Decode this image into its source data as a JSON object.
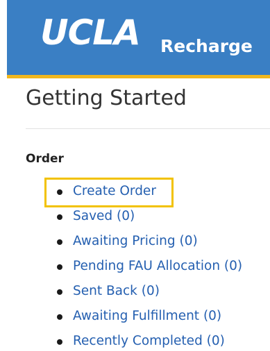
{
  "header": {
    "logo_text": "UCLA",
    "product_name": "Recharge",
    "colors": {
      "background": "#3a7fc4",
      "accent_border": "#f2b71c"
    }
  },
  "page": {
    "title": "Getting Started"
  },
  "order_section": {
    "heading": "Order",
    "items": [
      {
        "label": "Create Order",
        "highlighted": true
      },
      {
        "label": "Saved (0)"
      },
      {
        "label": "Awaiting Pricing (0)"
      },
      {
        "label": "Pending FAU Allocation (0)"
      },
      {
        "label": "Sent Back (0)"
      },
      {
        "label": "Awaiting Fulfillment (0)"
      },
      {
        "label": "Recently Completed (0)"
      }
    ]
  },
  "colors": {
    "link": "#245fb0",
    "highlight_box": "#f2c200"
  }
}
